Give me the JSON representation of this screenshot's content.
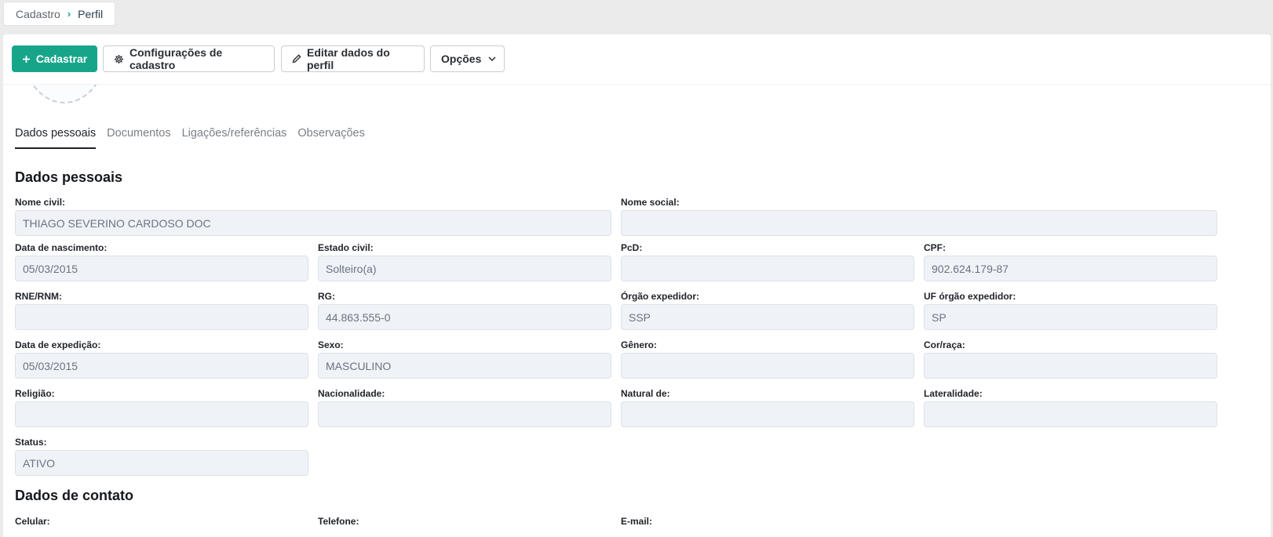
{
  "breadcrumb": {
    "items": [
      "Cadastro",
      "Perfil"
    ],
    "separator": "›"
  },
  "toolbar": {
    "register_label": "Cadastrar",
    "settings_label": "Configurações de cadastro",
    "edit_label": "Editar dados do perfil",
    "options_label": "Opções"
  },
  "tabs": [
    "Dados pessoais",
    "Documentos",
    "Ligações/referências",
    "Observações"
  ],
  "personal": {
    "title": "Dados pessoais",
    "fields": {
      "nome_civil": {
        "label": "Nome civil:",
        "value": "THIAGO SEVERINO CARDOSO DOC"
      },
      "nome_social": {
        "label": "Nome social:",
        "value": ""
      },
      "data_nascimento": {
        "label": "Data de nascimento:",
        "value": "05/03/2015"
      },
      "estado_civil": {
        "label": "Estado civil:",
        "value": "Solteiro(a)"
      },
      "pcd": {
        "label": "PcD:",
        "value": ""
      },
      "cpf": {
        "label": "CPF:",
        "value": "902.624.179-87"
      },
      "rne": {
        "label": "RNE/RNM:",
        "value": ""
      },
      "rg": {
        "label": "RG:",
        "value": "44.863.555-0"
      },
      "orgao": {
        "label": "Órgão expedidor:",
        "value": "SSP"
      },
      "uf_orgao": {
        "label": "UF órgão expedidor:",
        "value": "SP"
      },
      "data_expedicao": {
        "label": "Data de expedição:",
        "value": "05/03/2015"
      },
      "sexo": {
        "label": "Sexo:",
        "value": "MASCULINO"
      },
      "genero": {
        "label": "Gênero:",
        "value": ""
      },
      "cor_raca": {
        "label": "Cor/raça:",
        "value": ""
      },
      "religiao": {
        "label": "Religião:",
        "value": ""
      },
      "nacionalidade": {
        "label": "Nacionalidade:",
        "value": ""
      },
      "natural_de": {
        "label": "Natural de:",
        "value": ""
      },
      "lateralidade": {
        "label": "Lateralidade:",
        "value": ""
      },
      "status": {
        "label": "Status:",
        "value": "ATIVO"
      }
    }
  },
  "contact": {
    "title": "Dados de contato",
    "labels": [
      "Celular:",
      "Telefone:",
      "E-mail:"
    ]
  }
}
